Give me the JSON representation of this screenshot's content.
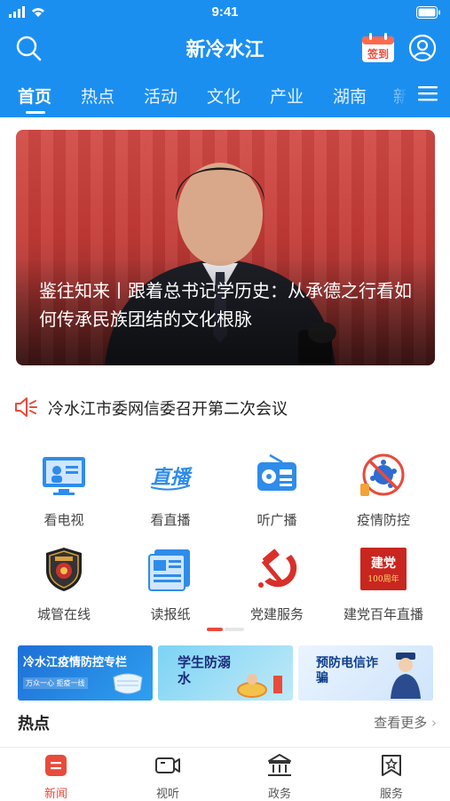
{
  "status_bar": {
    "time": "9:41"
  },
  "header": {
    "title": "新冷水江",
    "checkin_label": "签到"
  },
  "tabs": [
    {
      "label": "首页",
      "active": true
    },
    {
      "label": "热点"
    },
    {
      "label": "活动"
    },
    {
      "label": "文化"
    },
    {
      "label": "产业"
    },
    {
      "label": "湖南"
    },
    {
      "label": "新"
    }
  ],
  "hero": {
    "caption": "鉴往知来丨跟着总书记学历史：从承德之行看如何传承民族团结的文化根脉"
  },
  "notice": {
    "text": "冷水江市委网信委召开第二次会议"
  },
  "services": [
    {
      "label": "看电视",
      "icon": "tv-news-icon"
    },
    {
      "label": "看直播",
      "icon": "live-icon"
    },
    {
      "label": "听广播",
      "icon": "radio-icon"
    },
    {
      "label": "疫情防控",
      "icon": "virus-prevention-icon"
    },
    {
      "label": "城管在线",
      "icon": "urban-management-badge-icon"
    },
    {
      "label": "读报纸",
      "icon": "newspaper-icon"
    },
    {
      "label": "党建服务",
      "icon": "hammer-sickle-icon"
    },
    {
      "label": "建党百年直播",
      "icon": "party-centenary-icon",
      "badge_text": "建党",
      "badge_sub": "100周年"
    }
  ],
  "banners": [
    {
      "title": "冷水江疫情防控专栏",
      "sub": "万众一心 拒疫一线"
    },
    {
      "title": "学生防溺水"
    },
    {
      "title": "预防电信诈骗"
    }
  ],
  "hot_section": {
    "title": "热点",
    "more": "查看更多"
  },
  "tabbar": [
    {
      "label": "新闻",
      "active": true,
      "icon": "news-icon"
    },
    {
      "label": "视听",
      "icon": "video-camera-icon"
    },
    {
      "label": "政务",
      "icon": "government-building-icon"
    },
    {
      "label": "服务",
      "icon": "service-star-icon"
    }
  ],
  "colors": {
    "brand_blue": "#1b8ff0",
    "accent_red": "#e84b3c"
  }
}
